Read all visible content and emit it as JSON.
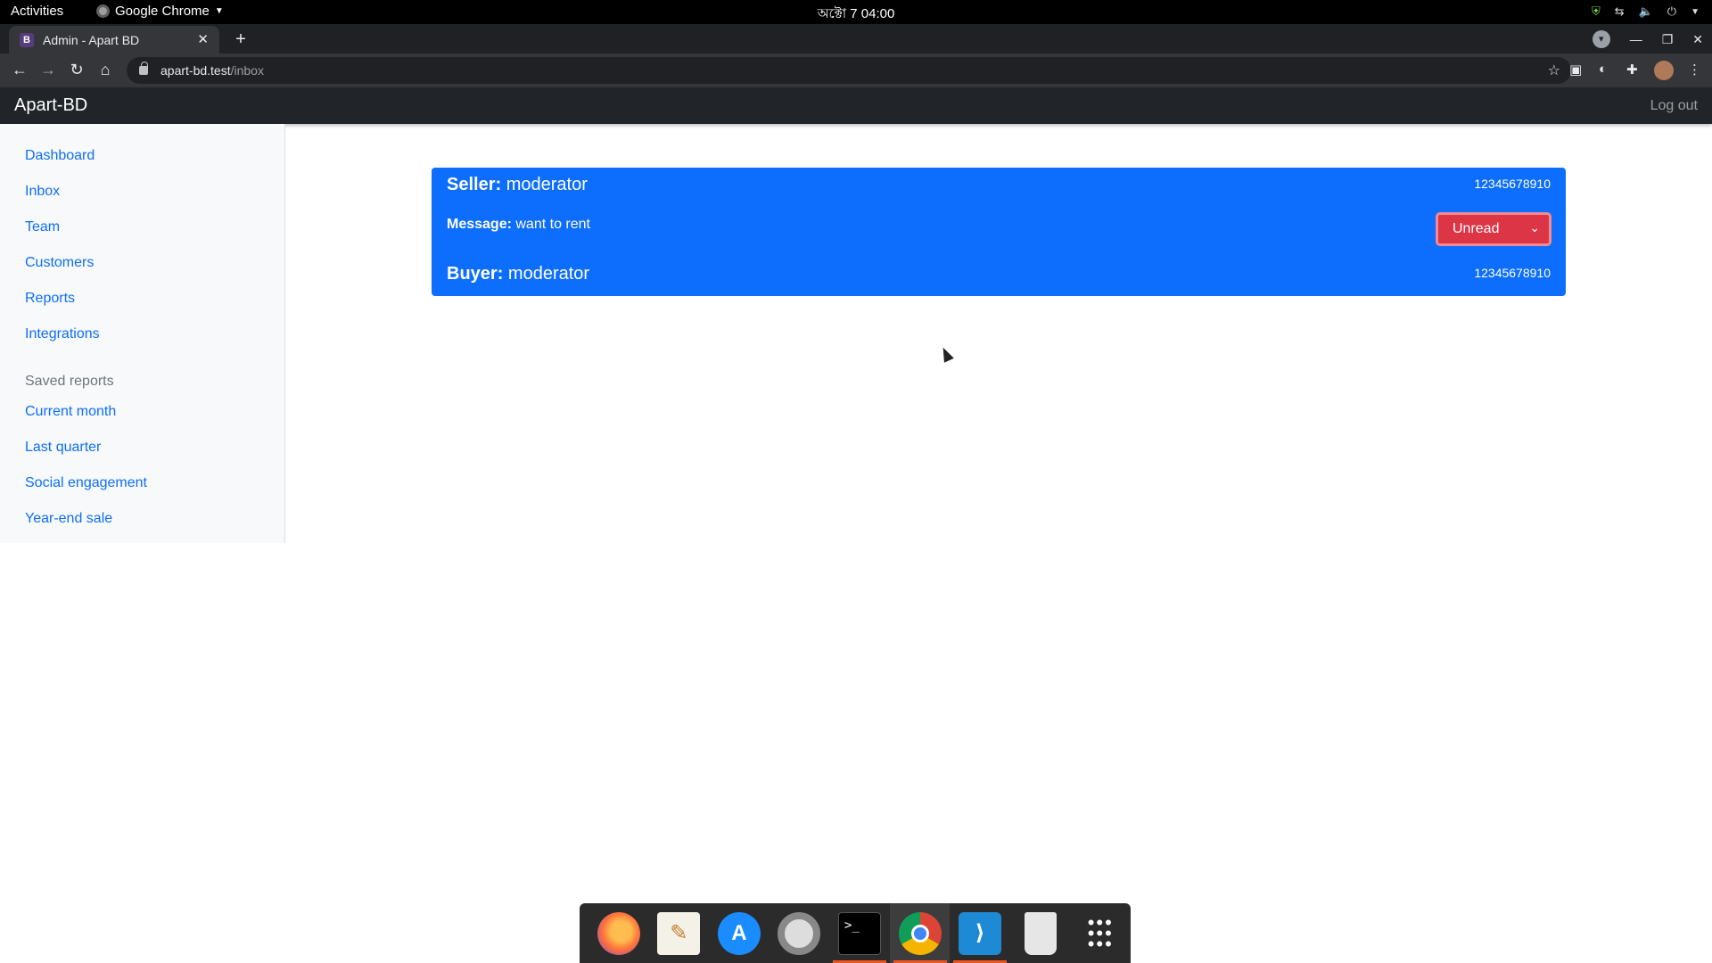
{
  "system_bar": {
    "activities": "Activities",
    "app_name": "Google Chrome",
    "clock": "অক্টো 7  04:00"
  },
  "browser": {
    "tab_title": "Admin - Apart BD",
    "tab_favicon": "B",
    "url_host": "apart-bd.test",
    "url_path": "/inbox"
  },
  "app": {
    "brand": "Apart-BD",
    "logout": "Log out"
  },
  "sidebar": {
    "items": [
      {
        "label": "Dashboard"
      },
      {
        "label": "Inbox"
      },
      {
        "label": "Team"
      },
      {
        "label": "Customers"
      },
      {
        "label": "Reports"
      },
      {
        "label": "Integrations"
      }
    ],
    "saved_heading": "Saved reports",
    "saved_items": [
      {
        "label": "Current month"
      },
      {
        "label": "Last quarter"
      },
      {
        "label": "Social engagement"
      },
      {
        "label": "Year-end sale"
      }
    ]
  },
  "message_card": {
    "seller_label": "Seller:",
    "seller_name": "moderator",
    "seller_phone": "12345678910",
    "message_label": "Message:",
    "message_text": "want to rent",
    "buyer_label": "Buyer:",
    "buyer_name": "moderator",
    "buyer_phone": "12345678910",
    "status_value": "Unread",
    "card_color": "#0d6efd",
    "status_color": "#dc3545"
  },
  "dock": {
    "apps": [
      "firefox-icon",
      "text-editor-icon",
      "app-store-icon",
      "help-icon",
      "terminal-icon",
      "chrome-icon",
      "vscode-icon",
      "trash-icon",
      "app-grid-icon"
    ]
  }
}
